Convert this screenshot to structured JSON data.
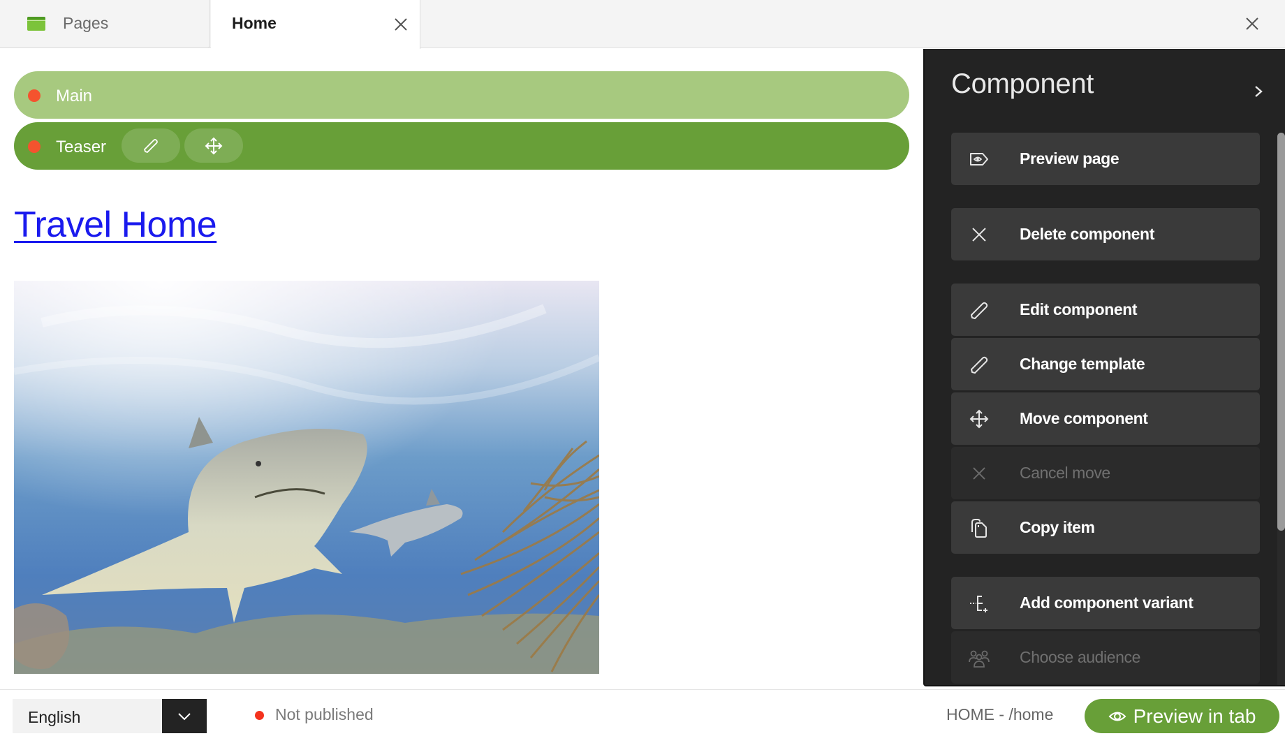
{
  "tabs": [
    {
      "label": "Pages",
      "icon": "pages-icon",
      "active": false
    },
    {
      "label": "Home",
      "icon": "close-icon",
      "active": true
    }
  ],
  "window": {
    "close_icon": "close-icon"
  },
  "areas": {
    "main": {
      "label": "Main",
      "status_color": "#f4532e"
    },
    "teaser": {
      "label": "Teaser",
      "status_color": "#f4532e",
      "actions": [
        "edit-icon",
        "move-icon"
      ]
    }
  },
  "page": {
    "title": "Travel Home",
    "image_alt": "Sharks swimming over a coral reef"
  },
  "panel": {
    "title": "Component",
    "collapse_icon": "chevron-right-icon",
    "items": [
      {
        "label": "Preview page",
        "icon": "preview-icon",
        "enabled": true
      },
      {
        "label": "Delete component",
        "icon": "close-icon",
        "enabled": true
      },
      {
        "label": "Edit component",
        "icon": "pencil-icon",
        "enabled": true
      },
      {
        "label": "Change template",
        "icon": "pencil-icon",
        "enabled": true
      },
      {
        "label": "Move component",
        "icon": "move-icon",
        "enabled": true
      },
      {
        "label": "Cancel move",
        "icon": "close-icon",
        "enabled": false
      },
      {
        "label": "Copy item",
        "icon": "copy-icon",
        "enabled": true
      },
      {
        "label": "Add component variant",
        "icon": "variant-icon",
        "enabled": true
      },
      {
        "label": "Choose audience",
        "icon": "audience-icon",
        "enabled": false
      }
    ]
  },
  "footer": {
    "language": {
      "value": "English"
    },
    "status": {
      "label": "Not published",
      "color": "#f4331e"
    },
    "path": "HOME - /home",
    "preview_button": {
      "label": "Preview in tab",
      "icon": "eye-icon"
    }
  },
  "colors": {
    "accent_green": "#689f38",
    "light_green": "#a7c97f",
    "panel_bg": "#232323",
    "link_blue": "#1a1aee"
  }
}
